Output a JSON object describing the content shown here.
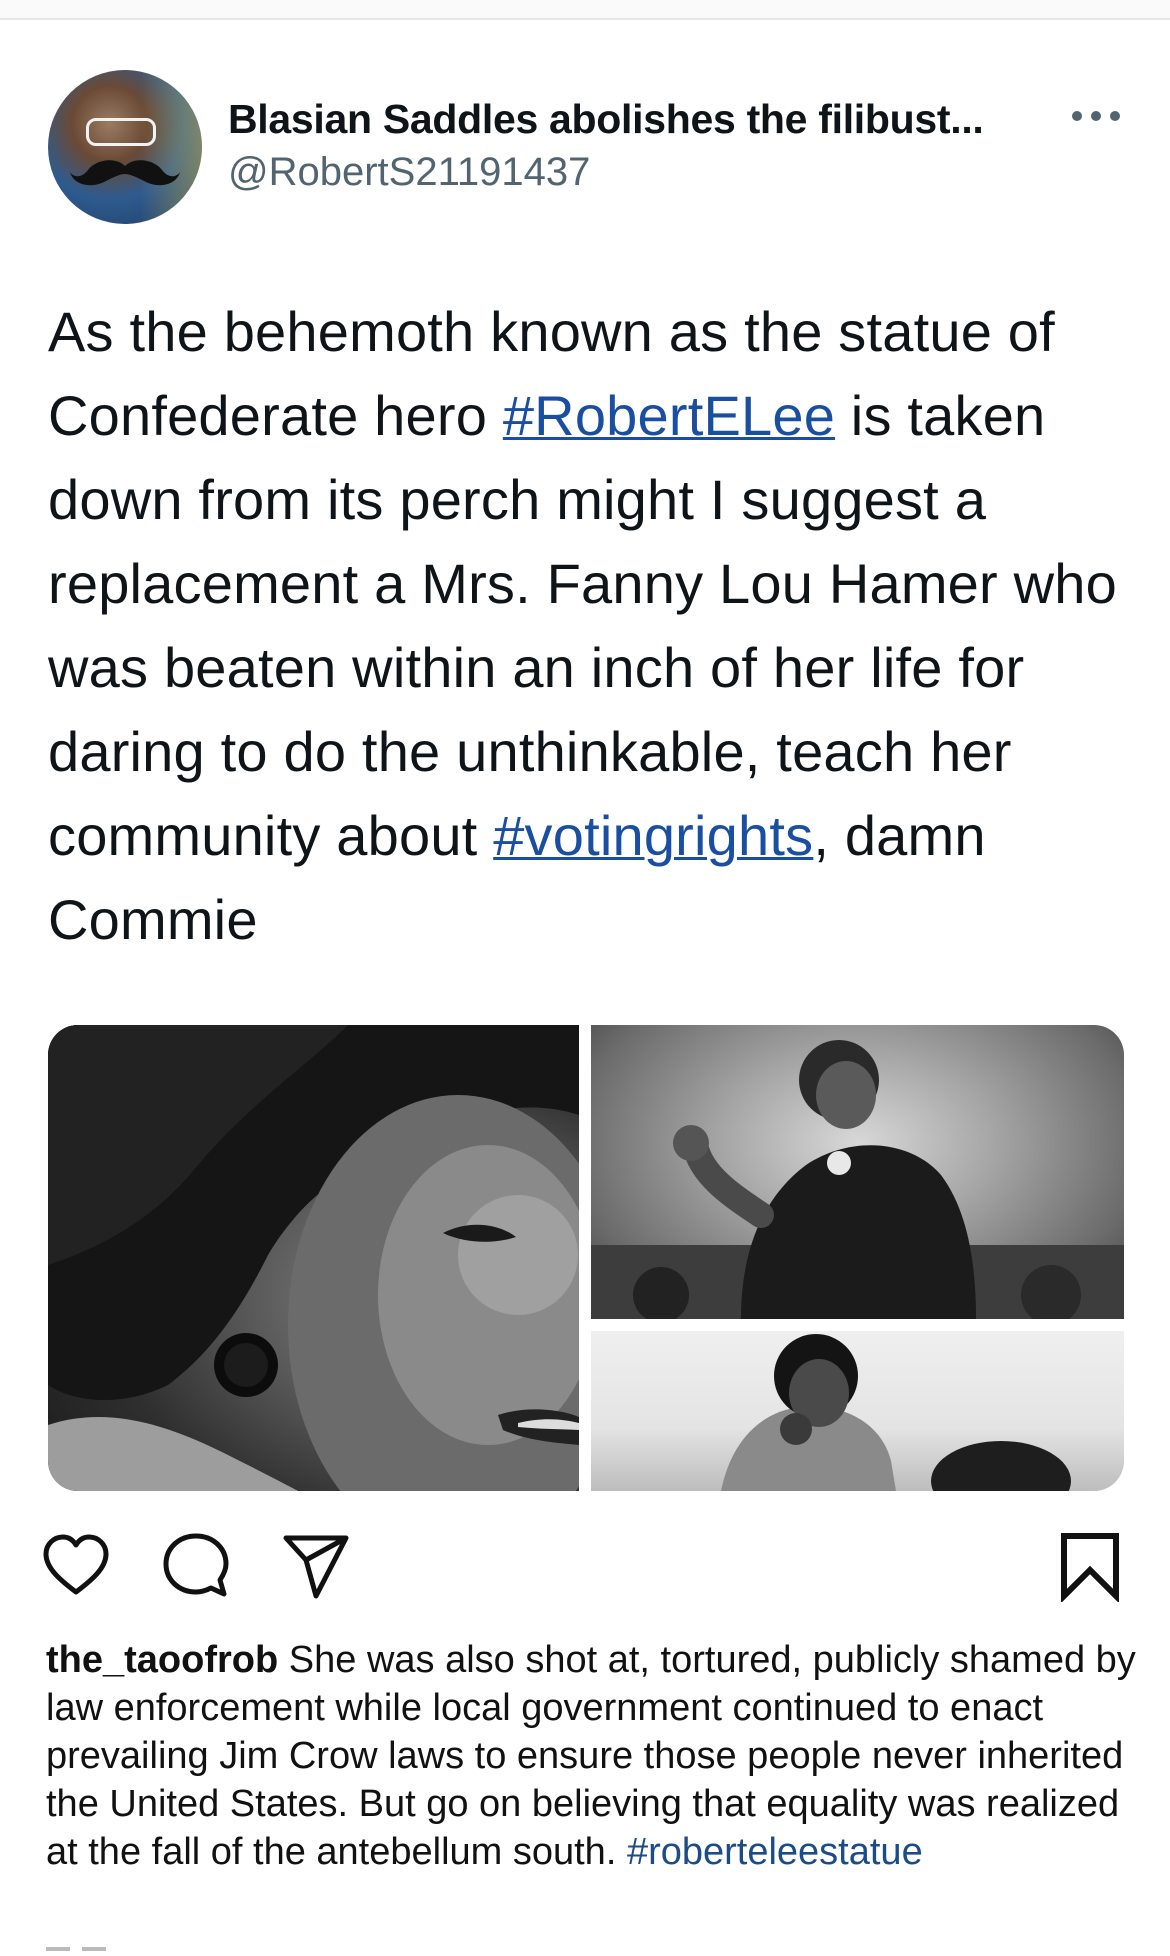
{
  "tweet": {
    "display_name": "Blasian Saddles abolishes the filibust...",
    "handle": "@RobertS21191437",
    "text_parts": {
      "p1": "As the behemoth known as the statue of Confederate hero ",
      "tag1": "#RobertELee",
      "p2": " is taken down from its perch might I suggest a replacement a Mrs. Fanny Lou Hamer who was beaten within an inch of her life for daring to do the unthinkable, teach her community about ",
      "tag2": "#votingrights",
      "p3": ", damn Commie"
    },
    "more_icon": "more-horizontal-icon",
    "media": [
      {
        "name": "photo-main"
      },
      {
        "name": "photo-top-right"
      },
      {
        "name": "photo-bottom-right"
      }
    ]
  },
  "actions": {
    "icons": [
      "heart-icon",
      "comment-icon",
      "share-icon",
      "bookmark-icon"
    ]
  },
  "comment": {
    "username": "the_taoofrob",
    "text": " She was also shot at, tortured, publicly shamed by law enforcement while local government continued to enact prevailing Jim Crow laws to ensure those people never inherited the United States. But go on believing that equality was realized at the fall of the antebellum south. ",
    "hashtag": "#roberteleestatue"
  },
  "colors": {
    "link_blue": "#1a4ea2",
    "hashtag_blue": "#1c4b89",
    "secondary_text": "#536471"
  }
}
